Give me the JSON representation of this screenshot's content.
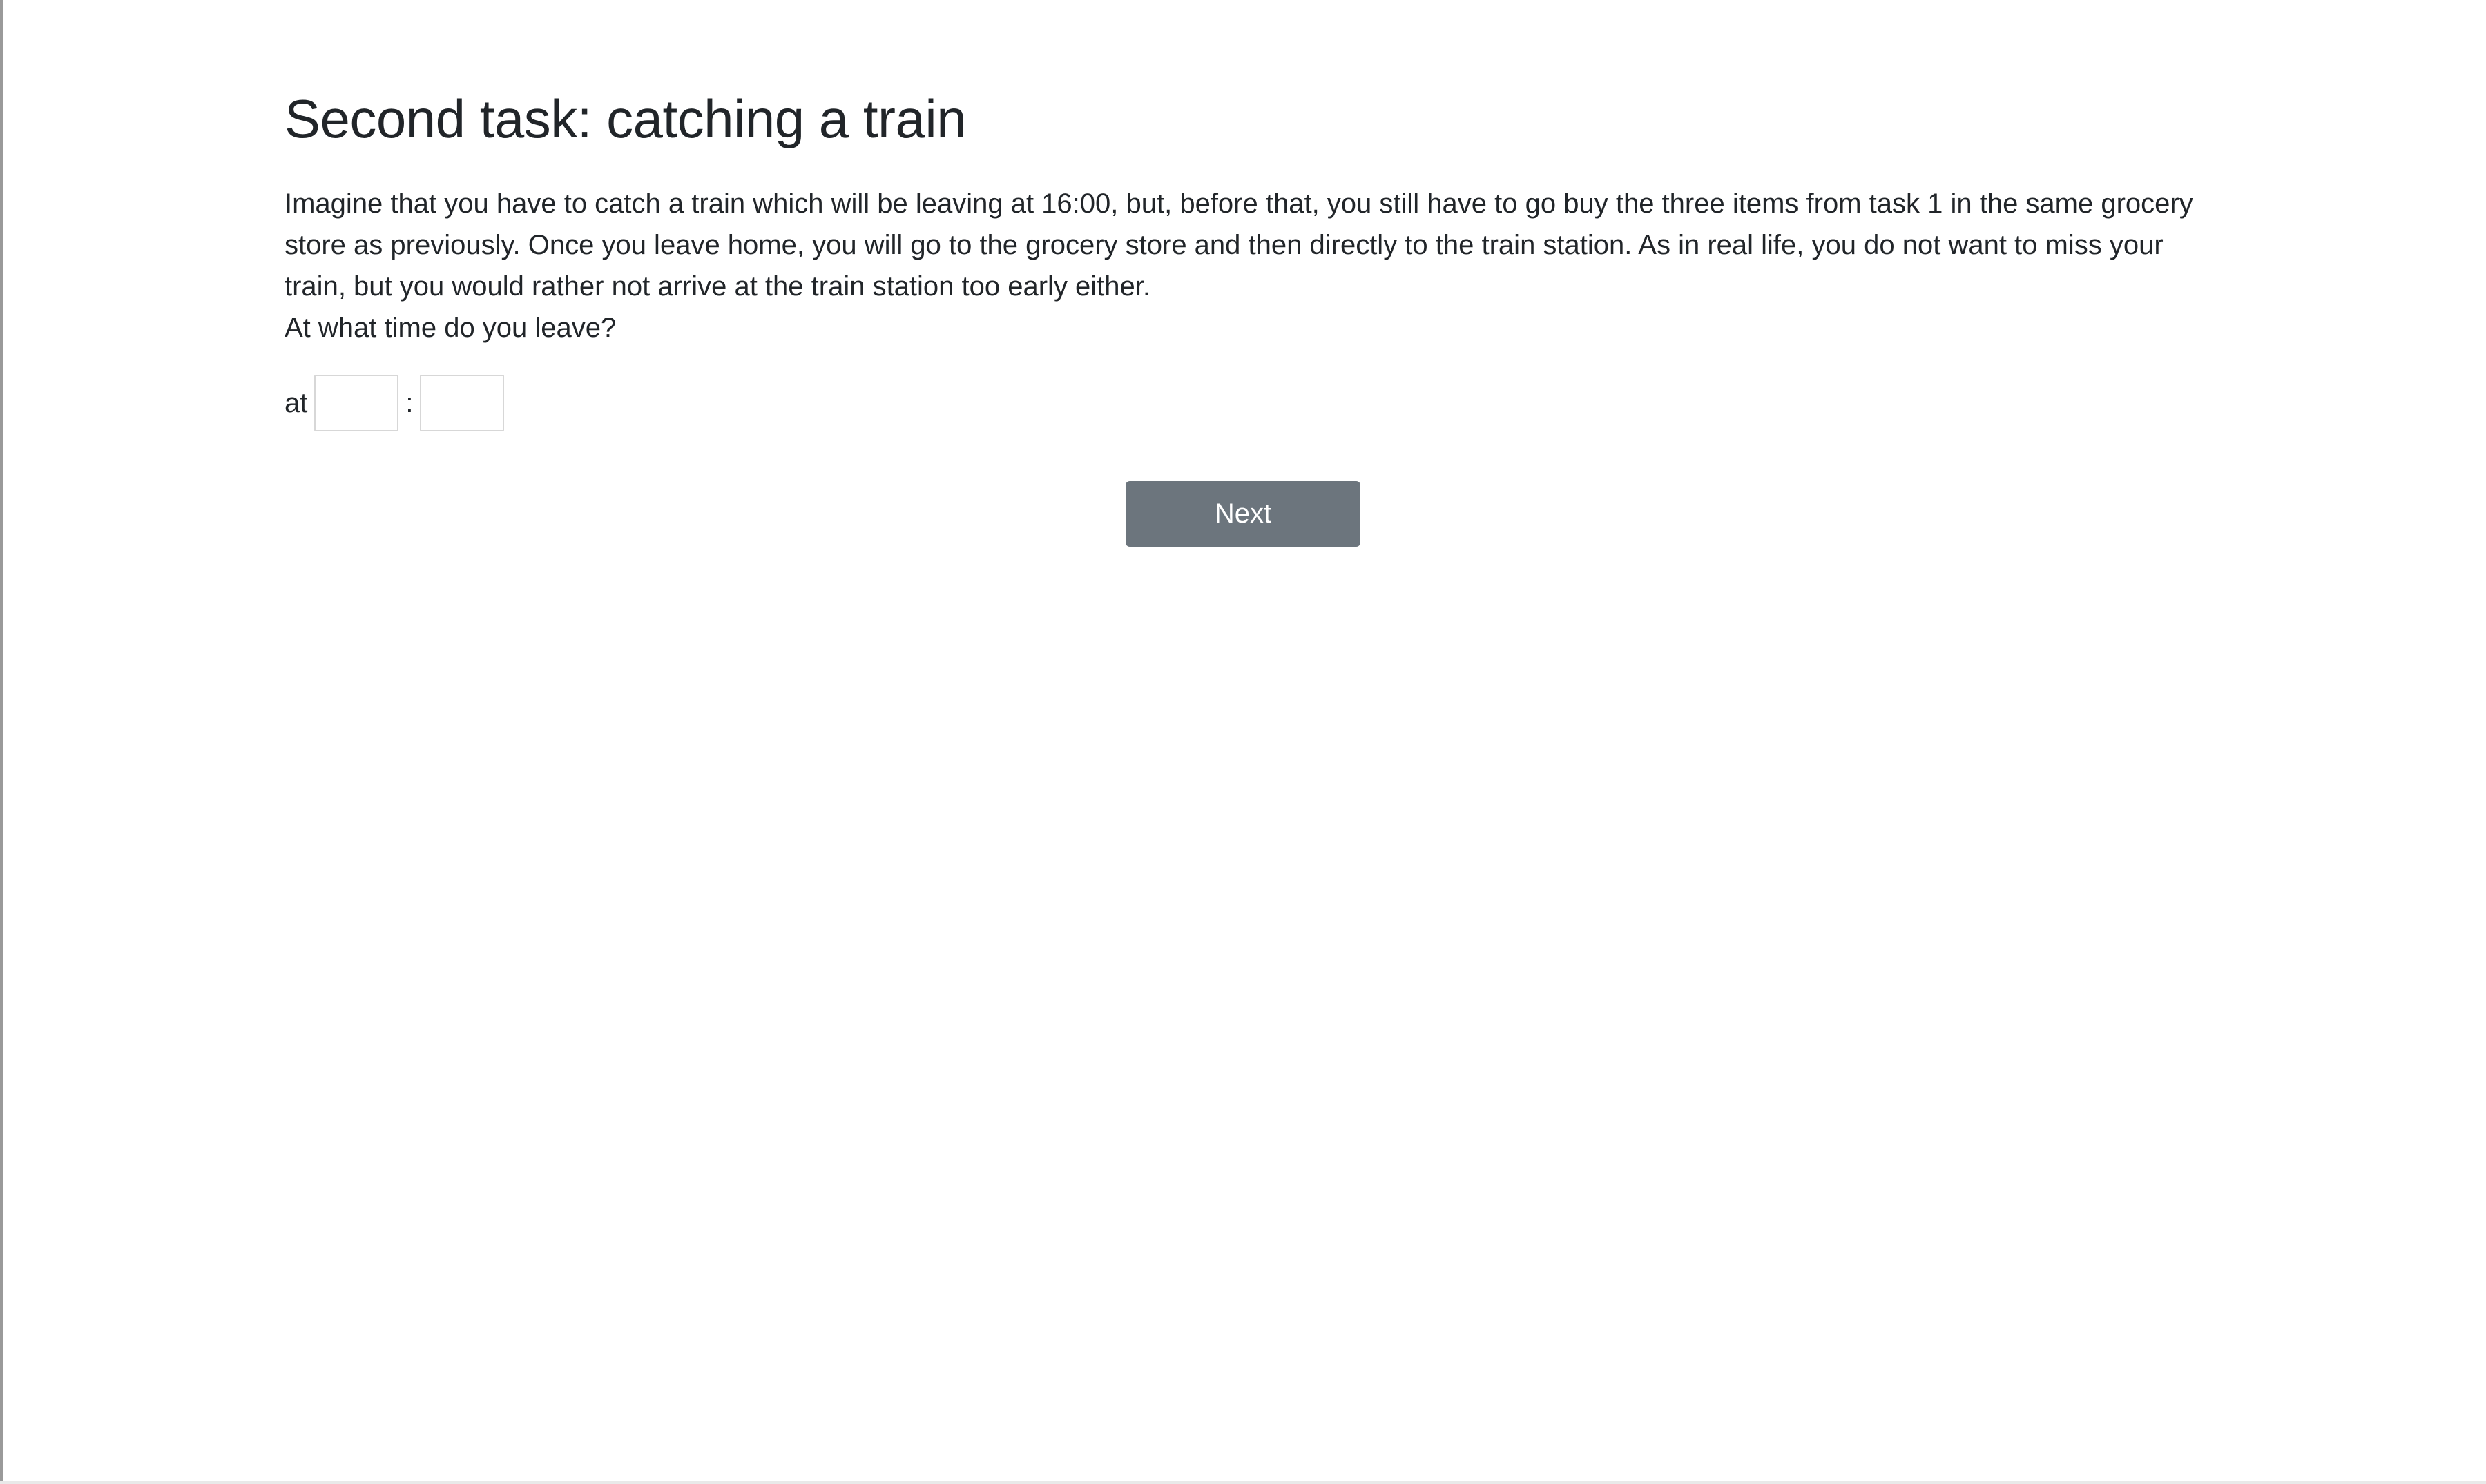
{
  "page": {
    "title": "Second task: catching a train",
    "paragraph": "Imagine that you have to catch a train which will be leaving at 16:00, but, before that, you still have to go buy the three items from task 1 in the same grocery store as previously. Once you leave home, you will go to the grocery store and then directly to the train station. As in real life, you do not want to miss your train, but you would rather not arrive at the train station too early either.",
    "question": "At what time do you leave?"
  },
  "time_input": {
    "prefix": "at",
    "separator": ":",
    "hours_value": "",
    "minutes_value": ""
  },
  "buttons": {
    "next_label": "Next"
  },
  "colors": {
    "button_bg": "#6c757d",
    "text": "#212529"
  }
}
